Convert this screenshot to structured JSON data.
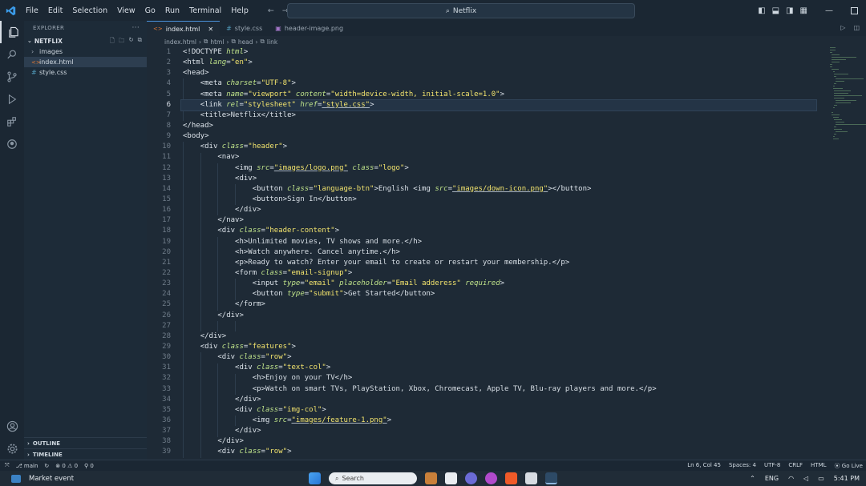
{
  "window": {
    "menu": [
      "File",
      "Edit",
      "Selection",
      "View",
      "Go",
      "Run",
      "Terminal",
      "Help"
    ],
    "search_title": "Netflix"
  },
  "sidebar": {
    "header": "EXPLORER",
    "project": "NETFLIX",
    "items": [
      {
        "label": "images",
        "type": "folder"
      },
      {
        "label": "index.html",
        "type": "html",
        "selected": true
      },
      {
        "label": "style.css",
        "type": "css"
      }
    ],
    "outline": "OUTLINE",
    "timeline": "TIMELINE"
  },
  "tabs": [
    {
      "label": "index.html",
      "active": true
    },
    {
      "label": "style.css",
      "active": false
    },
    {
      "label": "header-image.png",
      "active": false
    }
  ],
  "breadcrumb": [
    "index.html",
    "html",
    "head",
    "link"
  ],
  "editor": {
    "current_line": 6,
    "lines": [
      "<!DOCTYPE html>",
      "<html lang=\"en\">",
      "<head>",
      "    <meta charset=\"UTF-8\">",
      "    <meta name=\"viewport\" content=\"width=device-width, initial-scale=1.0\">",
      "    <link rel=\"stylesheet\" href=\"style.css\">",
      "    <title>Netflix</title>",
      "</head>",
      "<body>",
      "    <div class=\"header\">",
      "        <nav>",
      "            <img src=\"images/logo.png\" class=\"logo\">",
      "            <div>",
      "                <button class=\"language-btn\">English <img src=\"images/down-icon.png\"></button>",
      "                <button>Sign In</button>",
      "            </div>",
      "        </nav>",
      "        <div class=\"header-content\">",
      "            <h1>Unlimited movies, TV shows and more.</h1>",
      "            <h3>Watch anywhere. Cancel anytime.</h3>",
      "            <p>Ready to watch? Enter your email to create or restart your membership.</p>",
      "            <form class=\"email-signup\">",
      "                <input type=\"email\" placeholder=\"Email adderess\" required>",
      "                <button type=\"submit\">Get Started</button>",
      "            </form>",
      "        </div>",
      "",
      "    </div>",
      "    <div class=\"features\">",
      "        <div class=\"row\">",
      "            <div class=\"text-col\">",
      "                <h2>Enjoy on your TV</h2>",
      "                <p>Watch on smart TVs, PlayStation, Xbox, Chromecast, Apple TV, Blu-ray players and more.</p>",
      "            </div>",
      "            <div class=\"img-col\">",
      "                <img src=\"images/feature-1.png\">",
      "            </div>",
      "        </div>",
      "        <div class=\"row\">"
    ]
  },
  "status": {
    "branch": "main",
    "errors": "0",
    "warnings": "0",
    "ports": "0",
    "position": "Ln 6, Col 45",
    "spaces": "Spaces: 4",
    "encoding": "UTF-8",
    "eol": "CRLF",
    "language": "HTML",
    "live": "Go Live"
  },
  "taskbar": {
    "weather": "Market event",
    "search": "Search",
    "lang": "ENG",
    "time": "5:41 PM"
  },
  "colors": {
    "accent": "#4a90d9",
    "string": "#f2e36d",
    "attribute": "#bfe38a"
  }
}
